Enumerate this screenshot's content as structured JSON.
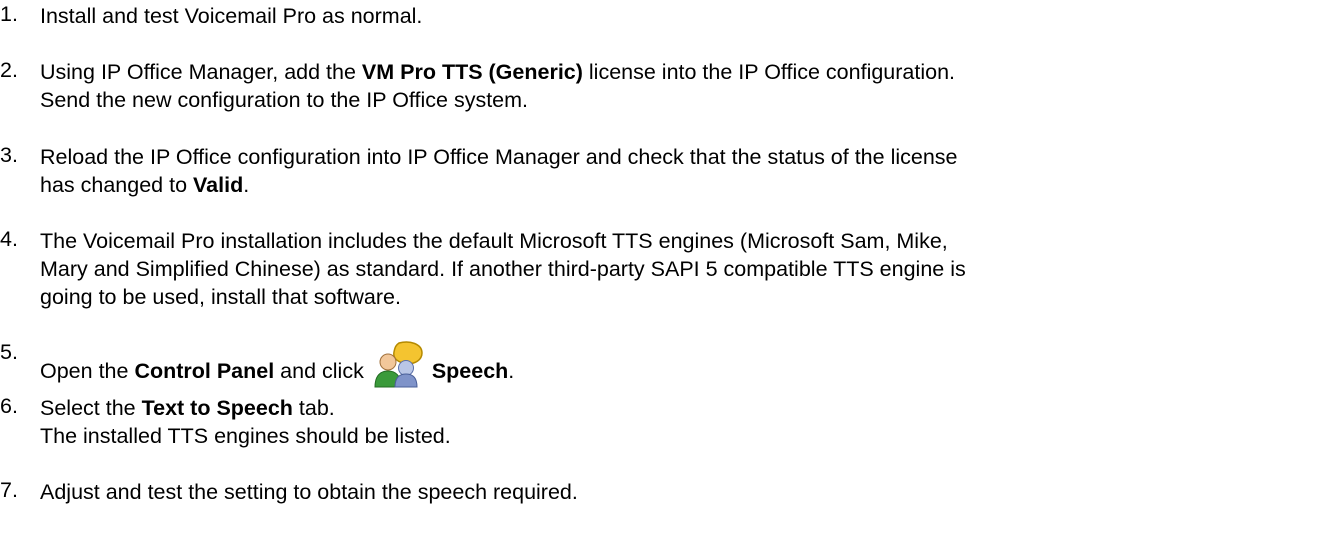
{
  "steps": [
    {
      "number": "1.",
      "lines": [
        [
          {
            "t": "Install and test Voicemail Pro as normal."
          }
        ]
      ]
    },
    {
      "number": "2.",
      "lines": [
        [
          {
            "t": "Using IP Office Manager, add the "
          },
          {
            "t": "VM Pro TTS (Generic)",
            "b": true
          },
          {
            "t": " license into the IP Office configuration."
          }
        ],
        [
          {
            "t": "Send the new configuration to the IP Office system."
          }
        ]
      ]
    },
    {
      "number": "3.",
      "lines": [
        [
          {
            "t": "Reload the IP Office configuration into IP Office Manager and check that the status of the license"
          }
        ],
        [
          {
            "t": "has changed to "
          },
          {
            "t": "Valid",
            "b": true
          },
          {
            "t": "."
          }
        ]
      ]
    },
    {
      "number": "4.",
      "lines": [
        [
          {
            "t": "The Voicemail Pro installation includes the default Microsoft TTS engines (Microsoft Sam, Mike,"
          }
        ],
        [
          {
            "t": "Mary and Simplified Chinese) as standard. If another third-party SAPI 5 compatible TTS engine is"
          }
        ],
        [
          {
            "t": "going to be used, install that software."
          }
        ]
      ]
    },
    {
      "number": "5.",
      "lines": [
        [
          {
            "t": "Open the "
          },
          {
            "t": "Control Panel",
            "b": true
          },
          {
            "t": " and click "
          },
          {
            "icon": "speech-icon"
          },
          {
            "t": "Speech",
            "b": true
          },
          {
            "t": "."
          }
        ]
      ]
    },
    {
      "number": "6.",
      "lines": [
        [
          {
            "t": "Select the "
          },
          {
            "t": "Text to Speech",
            "b": true
          },
          {
            "t": " tab."
          }
        ],
        [
          {
            "t": "The installed TTS engines should be listed."
          }
        ]
      ]
    },
    {
      "number": "7.",
      "lines": [
        [
          {
            "t": "Adjust and test the setting to obtain the speech required."
          }
        ]
      ]
    }
  ]
}
